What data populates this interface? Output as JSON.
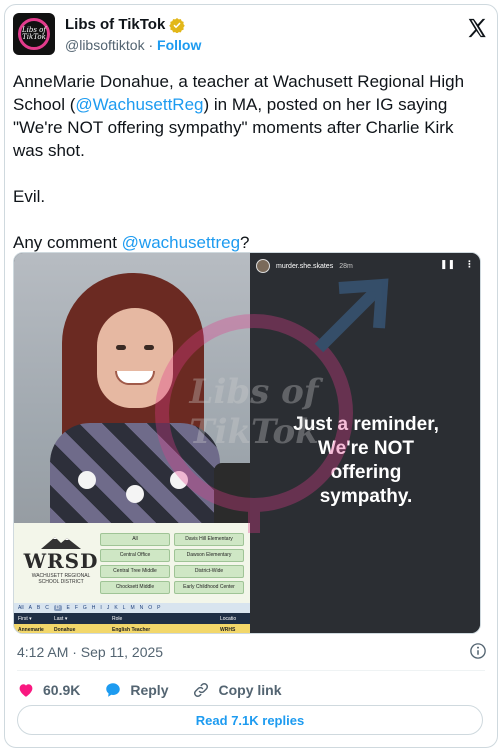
{
  "account": {
    "name": "Libs of TikTok",
    "handle": "@libsoftiktok",
    "separator": "·",
    "follow_label": "Follow",
    "avatar_text": "Libs of TikTok"
  },
  "tweet": {
    "line1_pre": "AnneMarie Donahue, a teacher at Wachusett Regional High School (",
    "line1_mention": "@WachusettReg",
    "line1_post": ") in MA, posted on her IG saying \"We're NOT offering sympathy\" moments after Charlie Kirk was shot.",
    "line2": "Evil.",
    "line3_pre": "Any comment ",
    "line3_mention": "@wachusettreg",
    "line3_post": "?"
  },
  "media": {
    "wrsd": {
      "title": "WRSD",
      "subtitle": "WACHUSETT REGIONAL SCHOOL DISTRICT",
      "buttons": [
        "All",
        "Davis Hill Elementary",
        "Central Office",
        "Dawson Elementary",
        "Central Tree Middle",
        "District-Wide",
        "Chocksett Middle",
        "Early Childhood Center"
      ],
      "alphabet": [
        "All",
        "A",
        "B",
        "C",
        "D",
        "E",
        "F",
        "G",
        "H",
        "I",
        "J",
        "K",
        "L",
        "M",
        "N",
        "O",
        "P"
      ],
      "selected_letter": "D",
      "table_headers": [
        "First ▾",
        "Last ▾",
        "Role",
        "Locatio"
      ],
      "table_row": [
        "Annemarie",
        "Donahue",
        "English Teacher",
        "WRHS"
      ]
    },
    "story": {
      "username": "murder.she.skates",
      "time": "28m",
      "text": "Just a reminder,\nWe're NOT\noffering\nsympathy."
    },
    "watermark_text": "Libs of TikTok"
  },
  "meta": {
    "timestamp": "4:12 AM · Sep 11, 2025"
  },
  "actions": {
    "likes": "60.9K",
    "reply_label": "Reply",
    "copy_link_label": "Copy link",
    "read_replies_label": "Read 7.1K replies"
  },
  "colors": {
    "accent": "#1d9bf0",
    "like": "#f91880",
    "text": "#0f1419",
    "muted": "#536471"
  }
}
